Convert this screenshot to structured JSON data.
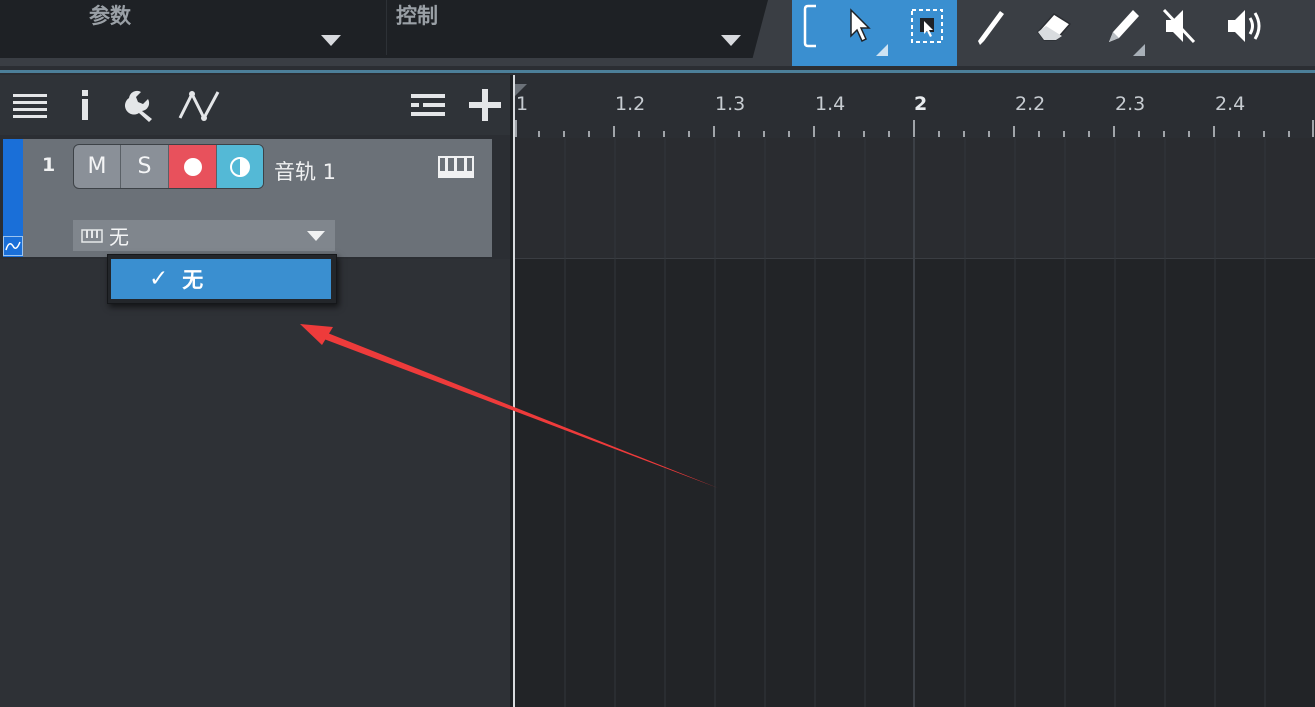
{
  "top": {
    "param_label": "参数",
    "control_label": "控制"
  },
  "toolbar": {
    "tools": [
      "bracket-icon",
      "arrow-pointer-icon",
      "range-select-icon",
      "knife-icon",
      "eraser-icon",
      "pencil-icon",
      "mute-icon",
      "speaker-icon"
    ],
    "active_color": "#3a8fd0"
  },
  "track_header": {
    "icons": [
      "list-icon",
      "info-icon",
      "wrench-icon",
      "automation-icon",
      "track-list-icon",
      "add-track-icon"
    ]
  },
  "track": {
    "number": "1",
    "mute_label": "M",
    "solo_label": "S",
    "name": "音轨 1",
    "input_value": "无",
    "color": "#1a6fd8"
  },
  "dropdown": {
    "selected_item": "无"
  },
  "ruler": {
    "labels": [
      "1",
      "1.2",
      "1.3",
      "1.4",
      "2",
      "2.2",
      "2.3",
      "2.4"
    ]
  },
  "annotation": {
    "arrow_color": "#ee3b3b"
  }
}
